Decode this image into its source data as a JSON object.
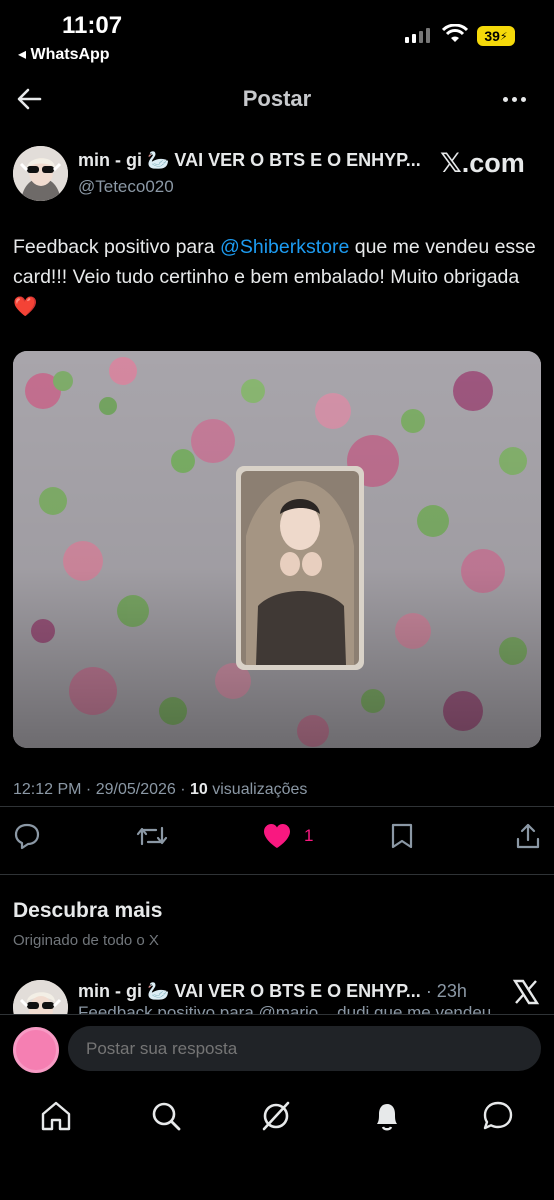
{
  "status": {
    "time": "11:07",
    "back_app": "◂ WhatsApp",
    "battery": "39"
  },
  "header": {
    "title": "Postar"
  },
  "tweet": {
    "author_name": "min - gi 🦢 VAI VER O BTS E O ENHYP...",
    "author_handle": "@Teteco020",
    "source_badge": "𝕏.com",
    "text_before": "Feedback positivo para ",
    "mention": "@Shiberkstore",
    "text_after": " que me vendeu esse card!!! Veio tudo certinho e bem embalado! Muito obrigada ❤️",
    "timestamp": "12:12 PM · 29/05/2026 · ",
    "views_count": "10",
    "views_label": " visualizações",
    "likes": "1"
  },
  "discover": {
    "title": "Descubra mais",
    "subtitle": "Originado de todo o X",
    "related": {
      "name": "min - gi 🦢 VAI VER O BTS E O ENHYP...",
      "time": " · 23h",
      "text": "Feedback positivo para @mario__dudi que me vendeu"
    }
  },
  "reply": {
    "placeholder": "Postar sua resposta"
  },
  "colors": {
    "accent": "#1d9bf0",
    "like": "#f91880",
    "background": "#000000"
  },
  "icons": [
    "back-arrow-icon",
    "more-icon",
    "reply-icon",
    "repost-icon",
    "like-icon",
    "bookmark-icon",
    "share-icon",
    "home-icon",
    "search-icon",
    "grok-icon",
    "notifications-icon",
    "messages-icon"
  ]
}
